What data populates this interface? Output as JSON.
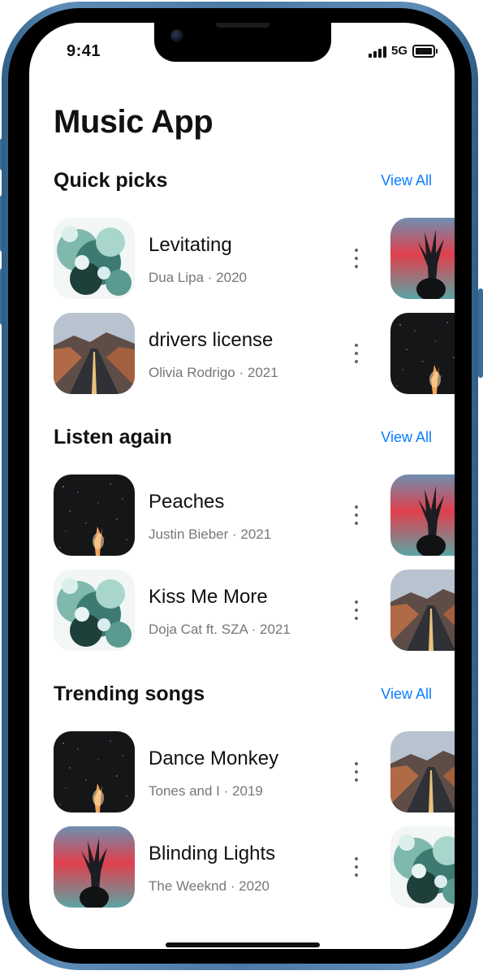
{
  "status_bar": {
    "time": "9:41",
    "network": "5G"
  },
  "app": {
    "title": "Music App"
  },
  "sections": [
    {
      "title": "Quick picks",
      "view_all": "View All",
      "songs": [
        {
          "title": "Levitating",
          "subtitle": "Dua Lipa · 2020",
          "art": "smoke-teal"
        },
        {
          "title": "drivers license",
          "subtitle": "Olivia Rodrigo · 2021",
          "art": "desert-road"
        }
      ],
      "next_art": [
        "red-sky-tree",
        "night-sparks"
      ]
    },
    {
      "title": "Listen again",
      "view_all": "View All",
      "songs": [
        {
          "title": "Peaches",
          "subtitle": "Justin Bieber · 2021",
          "art": "night-sparks"
        },
        {
          "title": "Kiss Me More",
          "subtitle": "Doja Cat ft. SZA · 2021",
          "art": "smoke-teal"
        }
      ],
      "next_art": [
        "red-sky-tree",
        "desert-road"
      ]
    },
    {
      "title": "Trending songs",
      "view_all": "View All",
      "songs": [
        {
          "title": "Dance Monkey",
          "subtitle": "Tones and I · 2019",
          "art": "night-sparks"
        },
        {
          "title": "Blinding Lights",
          "subtitle": "The Weeknd · 2020",
          "art": "red-sky-tree"
        }
      ],
      "next_art": [
        "desert-road",
        "smoke-teal"
      ]
    }
  ],
  "colors": {
    "accent": "#0a7cff",
    "frame": "#4a7aa6",
    "text": "#111111",
    "subtext": "#777777"
  },
  "icons": {
    "more": "more-vertical-icon",
    "signal": "cellular-signal-icon",
    "battery": "battery-icon"
  }
}
